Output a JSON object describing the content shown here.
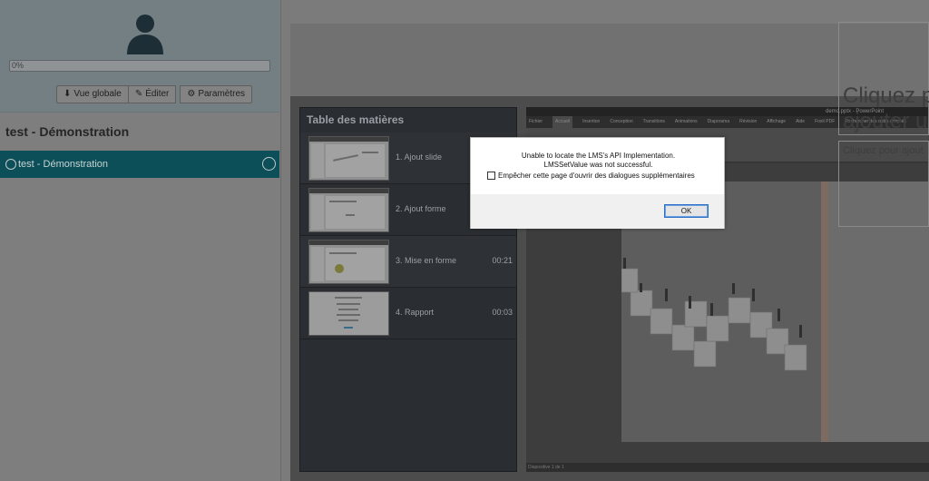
{
  "sidebar": {
    "progress_text": "0%",
    "progress_fraction": 0,
    "buttons": {
      "overview": "Vue globale",
      "edit": "Éditer",
      "settings": "Paramètres"
    },
    "course_title": "test - Démonstration",
    "course_item": "test - Démonstration"
  },
  "toc": {
    "title": "Table des matières",
    "items": [
      {
        "label": "1. Ajout slide",
        "time": ""
      },
      {
        "label": "2. Ajout forme",
        "time": ""
      },
      {
        "label": "3. Mise en forme",
        "time": "00:21"
      },
      {
        "label": "4. Rapport",
        "time": "00:03"
      }
    ]
  },
  "ppt": {
    "window_title": "demo.pptx - PowerPoint",
    "tabs": [
      "Fichier",
      "Accueil",
      "Insertion",
      "Conception",
      "Transitions",
      "Animations",
      "Diaporama",
      "Révision",
      "Affichage",
      "Aide",
      "Foxit PDF",
      "Rechercher des outils adaptés"
    ],
    "status": "Diapositive 1 de 1",
    "slide_title": "Cliquez p\najouter u",
    "slide_body": "Cliquez pour ajout"
  },
  "dialog": {
    "line1": "Unable to locate the LMS's API Implementation.",
    "line2": "LMSSetValue was not successful.",
    "checkbox_label": "Empêcher cette page d'ouvrir des dialogues supplémentaires",
    "ok": "OK"
  },
  "colors": {
    "accent": "#0c4f58",
    "dialog_button_border": "#2b6fc6"
  }
}
